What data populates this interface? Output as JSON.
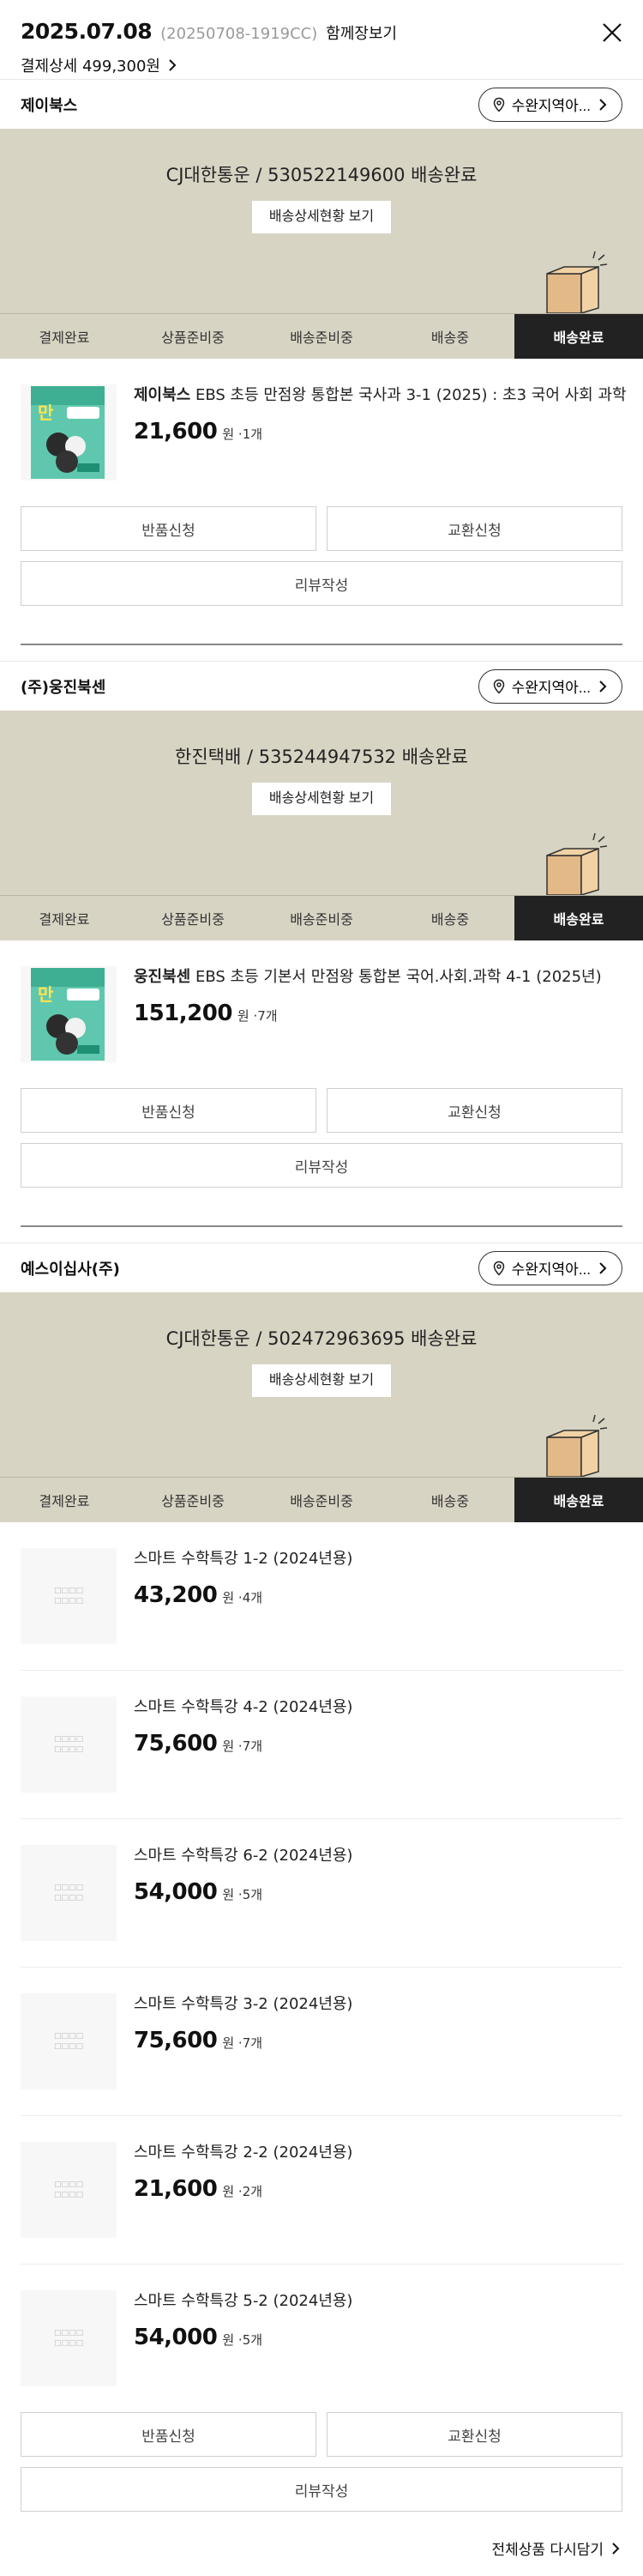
{
  "header": {
    "date": "2025.07.08",
    "order_no": "(20250708-1919CC)",
    "together": "함께장보기",
    "payment_detail": "결제상세 499,300원"
  },
  "steps": [
    "결제완료",
    "상품준비중",
    "배송준비중",
    "배송중",
    "배송완료"
  ],
  "common": {
    "region": "수완지역아...",
    "ship_detail_button": "배송상세현황 보기",
    "return_button": "반품신청",
    "exchange_button": "교환신청",
    "review_button": "리뷰작성",
    "unit_won": "원 · "
  },
  "sellers": [
    {
      "name": "제이북스",
      "ship_text": "CJ대한통운 / 530522149600 배송완료",
      "items": [
        {
          "brand": "제이북스",
          "title": " EBS 초등 만점왕 통합본 국사과 3-1 (2025) : 초3 국어 사회 과학",
          "price": "21,600",
          "qty": "1개"
        }
      ]
    },
    {
      "name": "(주)웅진북센",
      "ship_text": "한진택배 / 535244947532 배송완료",
      "items": [
        {
          "brand": "웅진북센",
          "title": " EBS 초등 기본서 만점왕 통합본 국어.사회.과학 4-1 (2025년)",
          "price": "151,200",
          "qty": "7개"
        }
      ]
    },
    {
      "name": "예스이십사(주)",
      "ship_text": "CJ대한통운 / 502472963695 배송완료",
      "items": [
        {
          "brand": "",
          "title": "스마트 수학특강 1-2 (2024년용)",
          "price": "43,200",
          "qty": "4개"
        },
        {
          "brand": "",
          "title": "스마트 수학특강 4-2 (2024년용)",
          "price": "75,600",
          "qty": "7개"
        },
        {
          "brand": "",
          "title": "스마트 수학특강 6-2 (2024년용)",
          "price": "54,000",
          "qty": "5개"
        },
        {
          "brand": "",
          "title": "스마트 수학특강 3-2 (2024년용)",
          "price": "75,600",
          "qty": "7개"
        },
        {
          "brand": "",
          "title": "스마트 수학특강 2-2 (2024년용)",
          "price": "21,600",
          "qty": "2개"
        },
        {
          "brand": "",
          "title": "스마트 수학특강 5-2 (2024년용)",
          "price": "54,000",
          "qty": "5개"
        }
      ]
    }
  ],
  "footer": {
    "redo": "전체상품 다시담기"
  },
  "colors": {
    "status_bg": "#d8d4c4",
    "active_step": "#222222",
    "box": "#e3b988"
  }
}
